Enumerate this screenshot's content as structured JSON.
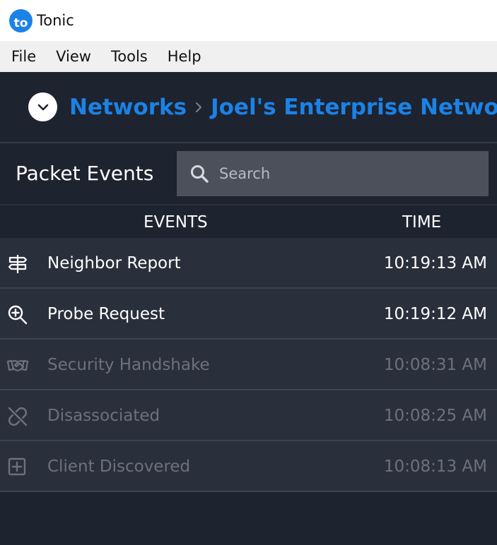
{
  "window": {
    "logo_text": "to",
    "title": "Tonic"
  },
  "menu": [
    "File",
    "View",
    "Tools",
    "Help"
  ],
  "breadcrumb": {
    "items": [
      "Networks",
      "Joel's Enterprise Network"
    ]
  },
  "panel": {
    "title": "Packet Events",
    "search_placeholder": "Search"
  },
  "table": {
    "headers": {
      "events": "EVENTS",
      "time": "TIME"
    },
    "rows": [
      {
        "icon": "neighbor-report-icon",
        "label": "Neighbor Report",
        "time": "10:19:13 AM",
        "state": "active"
      },
      {
        "icon": "zoom-in-icon",
        "label": "Probe Request",
        "time": "10:19:12 AM",
        "state": "active"
      },
      {
        "icon": "handshake-icon",
        "label": "Security Handshake",
        "time": "10:08:31 AM",
        "state": "muted"
      },
      {
        "icon": "unlink-icon",
        "label": "Disassociated",
        "time": "10:08:25 AM",
        "state": "muted"
      },
      {
        "icon": "plus-square-icon",
        "label": "Client Discovered",
        "time": "10:08:13 AM",
        "state": "muted"
      }
    ]
  },
  "colors": {
    "accent": "#1b82e6",
    "background": "#1e2330",
    "row": "#2a2f3c",
    "muted_text": "#6c717c"
  }
}
